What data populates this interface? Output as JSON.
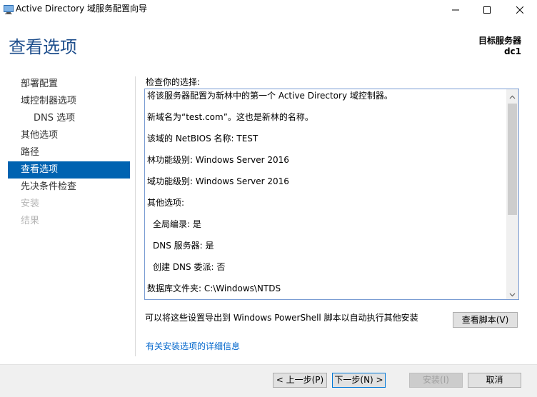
{
  "window": {
    "title": "Active Directory 域服务配置向导"
  },
  "header": {
    "page_title": "查看选项",
    "target_server_label": "目标服务器",
    "target_server_name": "dc1"
  },
  "nav": {
    "items": [
      {
        "label": "部署配置",
        "state": "normal"
      },
      {
        "label": "域控制器选项",
        "state": "normal"
      },
      {
        "label": "DNS 选项",
        "state": "normal"
      },
      {
        "label": "其他选项",
        "state": "normal"
      },
      {
        "label": "路径",
        "state": "normal"
      },
      {
        "label": "查看选项",
        "state": "active"
      },
      {
        "label": "先决条件检查",
        "state": "normal"
      },
      {
        "label": "安装",
        "state": "disabled"
      },
      {
        "label": "结果",
        "state": "disabled"
      }
    ]
  },
  "review": {
    "label": "检查你的选择:",
    "lines": [
      "将该服务器配置为新林中的第一个 Active Directory 域控制器。",
      "新域名为“test.com”。这也是新林的名称。",
      "该域的 NetBIOS 名称: TEST",
      "林功能级别: Windows Server 2016",
      "域功能级别: Windows Server 2016",
      "其他选项:",
      "全局编录: 是",
      "DNS 服务器: 是",
      "创建 DNS 委派: 否",
      "数据库文件夹: C:\\Windows\\NTDS"
    ]
  },
  "export": {
    "text": "可以将这些设置导出到 Windows PowerShell 脚本以自动执行其他安装",
    "view_script_button": "查看脚本(V)"
  },
  "help_link": "有关安装选项的详细信息",
  "footer": {
    "prev_button": "< 上一步(P)",
    "next_button": "下一步(N) >",
    "install_button": "安装(I)",
    "cancel_button": "取消"
  },
  "colors": {
    "accent": "#0063b1",
    "title_blue": "#1e4e8c",
    "link": "#0066cc"
  }
}
